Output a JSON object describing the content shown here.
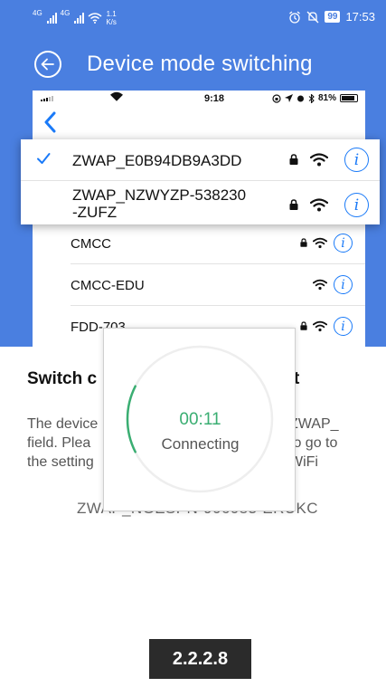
{
  "status_bar": {
    "sim1_label": "4G",
    "sim2_label": "4G",
    "net_speed_value": "1.1",
    "net_speed_unit": "K/s",
    "battery": "99",
    "time": "17:53",
    "icons": [
      "signal-icon",
      "signal-icon",
      "wifi-icon",
      "alarm-icon",
      "mute-icon",
      "battery-icon"
    ]
  },
  "header": {
    "title": "Device mode switching",
    "back_icon": "back-circle-icon",
    "color": "#4a7fe0"
  },
  "ios_screenshot": {
    "status": {
      "time": "9:18",
      "battery": "81%"
    },
    "highlighted_networks": [
      {
        "ssid": "ZWAP_E0B94DB9A3DD",
        "connected": true,
        "locked": true
      },
      {
        "ssid_line1": "ZWAP_NZWYZP-538230",
        "ssid_line2": "-ZUFZ",
        "connected": false,
        "locked": true
      }
    ],
    "networks": [
      {
        "ssid": "CMCC",
        "locked": true
      },
      {
        "ssid": "CMCC-EDU",
        "locked": false
      },
      {
        "ssid": "FDD-703",
        "locked": true
      }
    ],
    "accent": "#1a7af8"
  },
  "content": {
    "title_visible_start": "Switch c",
    "title_visible_end": "t",
    "desc_left": [
      "The device",
      "field. Plea",
      "the setting"
    ],
    "desc_right": [
      "ZWAP_",
      "to go to",
      "WiFi"
    ],
    "ssid_line": "ZWAP_NGESPN-906083-ERUKC"
  },
  "dialog": {
    "timer": "00:11",
    "status": "Connecting",
    "progress_fraction": 0.15,
    "timer_color": "#3aae72"
  },
  "badge": {
    "label": "2.2.2.8"
  }
}
